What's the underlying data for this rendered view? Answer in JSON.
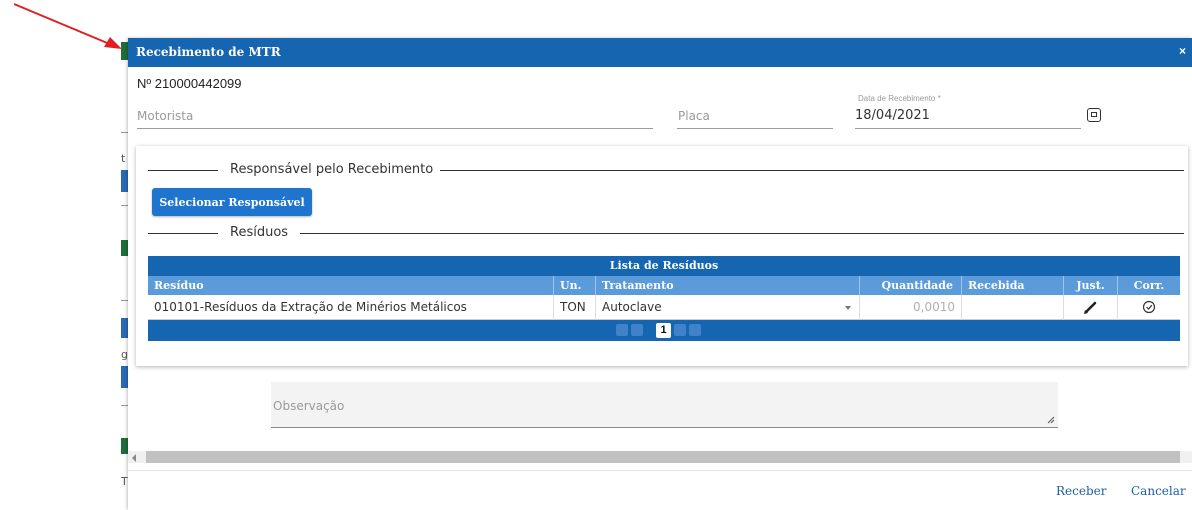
{
  "dialog": {
    "title": "Recebimento de MTR",
    "close_glyph": "×",
    "mtr_number": "Nº 210000442099"
  },
  "form": {
    "motorista_placeholder": "Motorista",
    "placa_placeholder": "Placa",
    "data_label": "Data de Recebimento *",
    "data_value": "18/04/2021"
  },
  "sections": {
    "responsavel": "Responsável pelo Recebimento",
    "residuos": "Resíduos"
  },
  "buttons": {
    "select_responsavel": "Selecionar Responsável",
    "receber": "Receber",
    "cancelar": "Cancelar"
  },
  "table": {
    "caption": "Lista de Resíduos",
    "columns": [
      "Resíduo",
      "Un.",
      "Tratamento",
      "Quantidade",
      "Recebida",
      "Just.",
      "Corr."
    ],
    "rows": [
      {
        "residuo": "010101-Resíduos da Extração de Minérios Metálicos",
        "un": "TON",
        "tratamento": "Autoclave",
        "quantidade": "0,0010",
        "recebida": ""
      }
    ],
    "pager": {
      "current_page": "1"
    }
  },
  "observacao_placeholder": "Observação",
  "colors": {
    "titlebar": "#1565b0",
    "table_header": "#5b9bd9",
    "primary_button": "#1f75cd",
    "annotation_arrow": "#e02020"
  }
}
